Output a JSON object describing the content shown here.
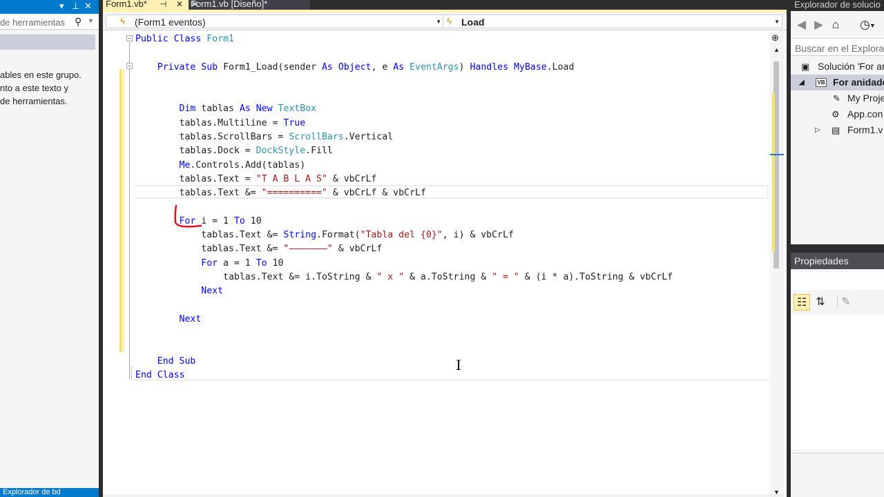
{
  "toolbox": {
    "pin_icon": "pin-icon",
    "close_icon": "close-icon",
    "search_placeholder": "de herramientas",
    "empty_message": [
      "ables en este grupo.",
      "nto a este texto y",
      " de herramientas."
    ],
    "bottom_label": "Explorador de bd"
  },
  "tabs": [
    {
      "label": "Form1.vb*",
      "active": true
    },
    {
      "label": "Form1.vb [Diseño]*",
      "active": false
    }
  ],
  "navbar": {
    "left": "(Form1 eventos)",
    "right": "Load"
  },
  "colors": {
    "keyword": "#0000ff",
    "type": "#2b91af",
    "string": "#a31515",
    "change_bar": "#fff1b4",
    "accent": "#007acc"
  },
  "code_lines": [
    [
      {
        "t": "Public",
        "c": "kw"
      },
      {
        "t": " "
      },
      {
        "t": "Class",
        "c": "kw"
      },
      {
        "t": " "
      },
      {
        "t": "Form1",
        "c": "ty"
      }
    ],
    [],
    [
      {
        "t": "    "
      },
      {
        "t": "Private",
        "c": "kw"
      },
      {
        "t": " "
      },
      {
        "t": "Sub",
        "c": "kw"
      },
      {
        "t": " Form1_Load(sender "
      },
      {
        "t": "As",
        "c": "kw"
      },
      {
        "t": " "
      },
      {
        "t": "Object",
        "c": "kw"
      },
      {
        "t": ", e "
      },
      {
        "t": "As",
        "c": "kw"
      },
      {
        "t": " "
      },
      {
        "t": "EventArgs",
        "c": "ty"
      },
      {
        "t": ") "
      },
      {
        "t": "Handles",
        "c": "kw"
      },
      {
        "t": " "
      },
      {
        "t": "MyBase",
        "c": "kw"
      },
      {
        "t": ".Load"
      }
    ],
    [],
    [],
    [
      {
        "t": "        "
      },
      {
        "t": "Dim",
        "c": "kw"
      },
      {
        "t": " tablas "
      },
      {
        "t": "As",
        "c": "kw"
      },
      {
        "t": " "
      },
      {
        "t": "New",
        "c": "kw"
      },
      {
        "t": " "
      },
      {
        "t": "TextBox",
        "c": "ty"
      }
    ],
    [
      {
        "t": "        tablas.Multiline = "
      },
      {
        "t": "True",
        "c": "kw"
      }
    ],
    [
      {
        "t": "        tablas.ScrollBars = "
      },
      {
        "t": "ScrollBars",
        "c": "ty"
      },
      {
        "t": ".Vertical"
      }
    ],
    [
      {
        "t": "        tablas.Dock = "
      },
      {
        "t": "DockStyle",
        "c": "ty"
      },
      {
        "t": ".Fill"
      }
    ],
    [
      {
        "t": "        "
      },
      {
        "t": "Me",
        "c": "kw"
      },
      {
        "t": ".Controls.Add(tablas)"
      }
    ],
    [
      {
        "t": "        tablas.Text = "
      },
      {
        "t": "\"T A B L A S\"",
        "c": "st"
      },
      {
        "t": " & vbCrLf"
      }
    ],
    [
      {
        "t": "        tablas.Text &= "
      },
      {
        "t": "\"==========\"",
        "c": "st"
      },
      {
        "t": " & vbCrLf & vbCrLf"
      }
    ],
    [],
    [
      {
        "t": "        "
      },
      {
        "t": "For",
        "c": "kw"
      },
      {
        "t": " i = 1 "
      },
      {
        "t": "To",
        "c": "kw"
      },
      {
        "t": " 10"
      }
    ],
    [
      {
        "t": "            tablas.Text &= "
      },
      {
        "t": "String",
        "c": "kw"
      },
      {
        "t": ".Format("
      },
      {
        "t": "\"Tabla del {0}\"",
        "c": "st"
      },
      {
        "t": ", i) & vbCrLf"
      }
    ],
    [
      {
        "t": "            tablas.Text &= "
      },
      {
        "t": "\"———————\"",
        "c": "st"
      },
      {
        "t": " & vbCrLf"
      }
    ],
    [
      {
        "t": "            "
      },
      {
        "t": "For",
        "c": "kw"
      },
      {
        "t": " a = 1 "
      },
      {
        "t": "To",
        "c": "kw"
      },
      {
        "t": " 10"
      }
    ],
    [
      {
        "t": "                tablas.Text &= i.ToString & "
      },
      {
        "t": "\" x \"",
        "c": "st"
      },
      {
        "t": " & a.ToString & "
      },
      {
        "t": "\" = \"",
        "c": "st"
      },
      {
        "t": " & (i * a).ToString & vbCrLf"
      }
    ],
    [
      {
        "t": "            "
      },
      {
        "t": "Next",
        "c": "kw"
      }
    ],
    [],
    [
      {
        "t": "        "
      },
      {
        "t": "Next",
        "c": "kw"
      }
    ],
    [],
    [],
    [
      {
        "t": "    "
      },
      {
        "t": "End",
        "c": "kw"
      },
      {
        "t": " "
      },
      {
        "t": "Sub",
        "c": "kw"
      }
    ],
    [
      {
        "t": "End",
        "c": "kw"
      },
      {
        "t": " "
      },
      {
        "t": "Class",
        "c": "kw"
      }
    ]
  ],
  "solution_explorer": {
    "title": "Explorador de solucio",
    "search_placeholder": "Buscar en el Explorad",
    "tree": [
      {
        "label": "Solución 'For an",
        "icon": "solution-icon",
        "level": 0,
        "arrow": "",
        "selected": false
      },
      {
        "label": "For anidado",
        "icon": "vb-project-icon",
        "level": 1,
        "arrow": "expanded",
        "selected": true
      },
      {
        "label": "My Proje",
        "icon": "wrench-icon",
        "level": 2,
        "arrow": "",
        "selected": false
      },
      {
        "label": "App.con",
        "icon": "config-icon",
        "level": 2,
        "arrow": "",
        "selected": false
      },
      {
        "label": "Form1.v",
        "icon": "form-icon",
        "level": 2,
        "arrow": "collapsed",
        "selected": false
      }
    ]
  },
  "properties": {
    "title": "Propiedades"
  }
}
